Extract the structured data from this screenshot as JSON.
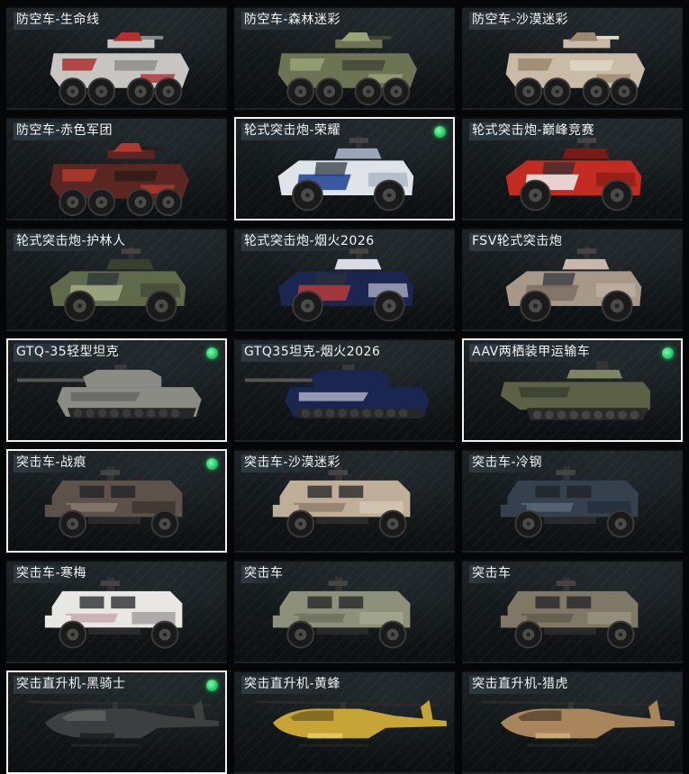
{
  "vehicles": [
    {
      "name": "防空车-生命线",
      "owned": false,
      "selected": false,
      "type": "aa",
      "camo": [
        "#c8c6c2",
        "#b0302e",
        "#8a8a86"
      ]
    },
    {
      "name": "防空车-森林迷彩",
      "owned": false,
      "selected": false,
      "type": "aa",
      "camo": [
        "#6d7454",
        "#9aa27a",
        "#3f4634"
      ]
    },
    {
      "name": "防空车-沙漠迷彩",
      "owned": false,
      "selected": false,
      "type": "aa",
      "camo": [
        "#c9bba7",
        "#9c8770",
        "#e3d9cb"
      ]
    },
    {
      "name": "防空车-赤色军团",
      "owned": false,
      "selected": false,
      "type": "aa",
      "camo": [
        "#5b2622",
        "#b1392e",
        "#2b1a18"
      ]
    },
    {
      "name": "轮式突击炮-荣耀",
      "owned": true,
      "selected": true,
      "type": "assault_gun",
      "camo": [
        "#dfe3ea",
        "#1c3f8f",
        "#9aa6b8"
      ]
    },
    {
      "name": "轮式突击炮-巅峰竞赛",
      "owned": false,
      "selected": false,
      "type": "assault_gun",
      "camo": [
        "#c22b20",
        "#eeeeee",
        "#7a1a14"
      ]
    },
    {
      "name": "轮式突击炮-护林人",
      "owned": false,
      "selected": false,
      "type": "assault_gun",
      "camo": [
        "#5f6a4c",
        "#a3aa86",
        "#3a4030"
      ]
    },
    {
      "name": "轮式突击炮-烟火2026",
      "owned": false,
      "selected": false,
      "type": "assault_gun",
      "camo": [
        "#1b2650",
        "#b83a3a",
        "#d9dbe6"
      ]
    },
    {
      "name": "FSV轮式突击炮",
      "owned": false,
      "selected": false,
      "type": "assault_gun",
      "camo": [
        "#a7988a",
        "#7c6e62",
        "#c6b8aa"
      ]
    },
    {
      "name": "GTQ-35轻型坦克",
      "owned": true,
      "selected": true,
      "type": "tank",
      "camo": [
        "#8b8b86",
        "#5e5e5a",
        "#b5b4ae"
      ]
    },
    {
      "name": "GTQ35坦克-烟火2026",
      "owned": false,
      "selected": false,
      "type": "tank",
      "camo": [
        "#1a2552",
        "#c7c9da",
        "#b23333"
      ]
    },
    {
      "name": "AAV两栖装甲运输车",
      "owned": true,
      "selected": true,
      "type": "amphibious",
      "camo": [
        "#5b6046",
        "#7f8562",
        "#3a3e2e"
      ]
    },
    {
      "name": "突击车-战痕",
      "owned": true,
      "selected": true,
      "type": "assault_car",
      "camo": [
        "#5d524a",
        "#8a7d72",
        "#2f2a26"
      ]
    },
    {
      "name": "突击车-沙漠迷彩",
      "owned": false,
      "selected": false,
      "type": "assault_car",
      "camo": [
        "#bfae98",
        "#8d7a65",
        "#ddd0bf"
      ]
    },
    {
      "name": "突击车-冷钢",
      "owned": false,
      "selected": false,
      "type": "assault_car",
      "camo": [
        "#34404e",
        "#5d6c7c",
        "#222a33"
      ]
    },
    {
      "name": "突击车-寒梅",
      "owned": false,
      "selected": false,
      "type": "assault_car",
      "camo": [
        "#e9e7e3",
        "#c4a6ad",
        "#8a8486"
      ]
    },
    {
      "name": "突击车",
      "owned": false,
      "selected": false,
      "type": "assault_car",
      "camo": [
        "#8e917a",
        "#6c6f5c",
        "#aeb09a"
      ]
    },
    {
      "name": "突击车",
      "owned": false,
      "selected": false,
      "type": "assault_car",
      "camo": [
        "#807867",
        "#5f5a4d",
        "#a59d8b"
      ]
    },
    {
      "name": "突击直升机-黑骑士",
      "owned": true,
      "selected": true,
      "type": "helicopter",
      "camo": [
        "#3c3f3f",
        "#5c605f",
        "#222424"
      ]
    },
    {
      "name": "突击直升机-黄蜂",
      "owned": false,
      "selected": false,
      "type": "helicopter",
      "camo": [
        "#c7a436",
        "#7a6422",
        "#e2c65c"
      ]
    },
    {
      "name": "突击直升机-猎虎",
      "owned": false,
      "selected": false,
      "type": "helicopter",
      "camo": [
        "#a8855a",
        "#5a4630",
        "#c9a878"
      ]
    }
  ]
}
